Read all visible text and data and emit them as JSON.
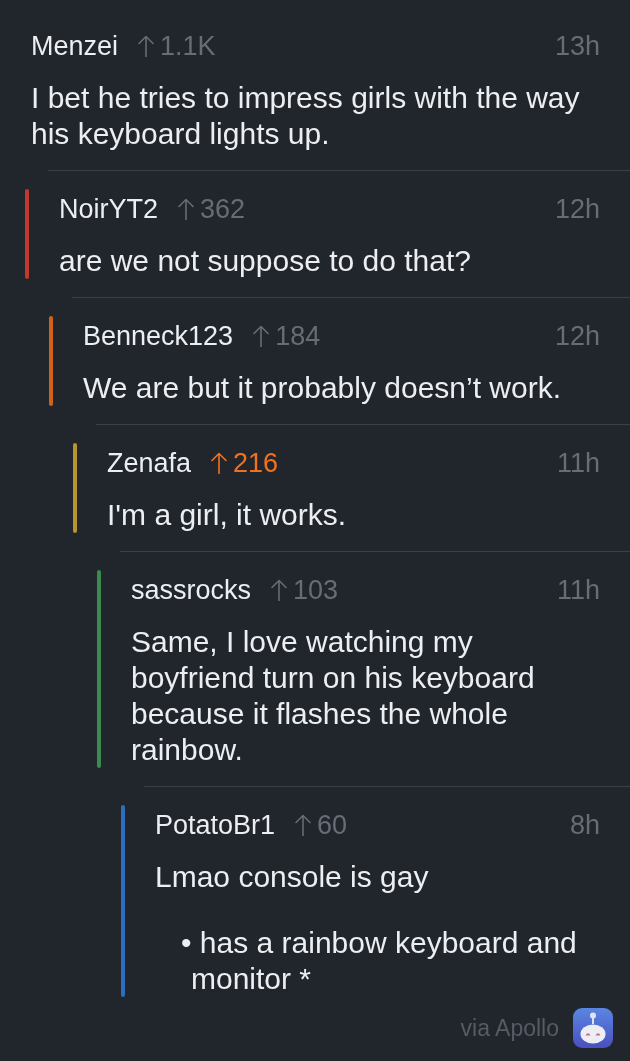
{
  "comments": [
    {
      "author": "Menzei",
      "score": "1.1K",
      "upvoted": false,
      "time": "13h",
      "body": [
        {
          "kind": "text",
          "text": "I bet he tries to impress girls with the way his keyboard lights up."
        }
      ],
      "children": [
        {
          "author": "NoirYT2",
          "score": "362",
          "upvoted": false,
          "time": "12h",
          "color": "#c2382c",
          "body": [
            {
              "kind": "text",
              "text": "are we not suppose to do that?"
            }
          ],
          "children": [
            {
              "author": "Benneck123",
              "score": "184",
              "upvoted": false,
              "time": "12h",
              "color": "#cd6419",
              "body": [
                {
                  "kind": "text",
                  "text": "We are but it probably doesn’t work."
                }
              ],
              "children": [
                {
                  "author": "Zenafa",
                  "score": "216",
                  "upvoted": true,
                  "time": "11h",
                  "color": "#b4952f",
                  "body": [
                    {
                      "kind": "text",
                      "text": "I'm a girl, it works."
                    }
                  ],
                  "children": [
                    {
                      "author": "sassrocks",
                      "score": "103",
                      "upvoted": false,
                      "time": "11h",
                      "color": "#3b8a50",
                      "body": [
                        {
                          "kind": "text",
                          "text": "Same, I love watching my boyfriend turn on his keyboard because it flashes the whole rainbow."
                        }
                      ],
                      "children": [
                        {
                          "author": "PotatoBr1",
                          "score": "60",
                          "upvoted": false,
                          "time": "8h",
                          "color": "#2d6ebf",
                          "body": [
                            {
                              "kind": "text",
                              "text": "Lmao console is gay"
                            },
                            {
                              "kind": "list_item",
                              "text": "• has a rainbow keyboard and monitor *"
                            }
                          ]
                        }
                      ]
                    }
                  ]
                }
              ]
            }
          ]
        }
      ]
    }
  ],
  "footer": {
    "label": "via Apollo"
  }
}
